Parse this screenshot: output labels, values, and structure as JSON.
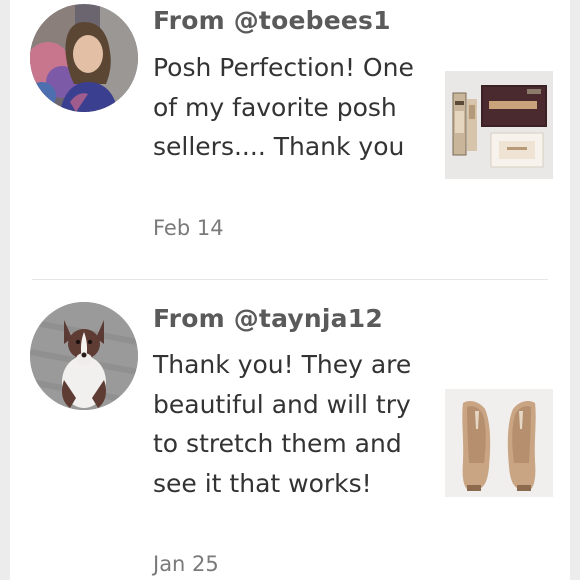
{
  "reviews": [
    {
      "from": "From @toebees1",
      "message": "Posh Perfection! One of my favorite posh sellers.... Thank you",
      "date": "Feb 14",
      "avatar_icon": "user-photo-woman",
      "product_icon": "makeup-palette-photo"
    },
    {
      "from": "From @taynja12",
      "message": "Thank you! They are beautiful and will try to stretch them and see it that works!",
      "date": "Jan 25",
      "avatar_icon": "user-photo-dog",
      "product_icon": "heels-photo"
    }
  ],
  "colors": {
    "username": "#5a5a5a",
    "message": "#333333",
    "date": "#7a7a7a",
    "background": "#ffffff"
  }
}
